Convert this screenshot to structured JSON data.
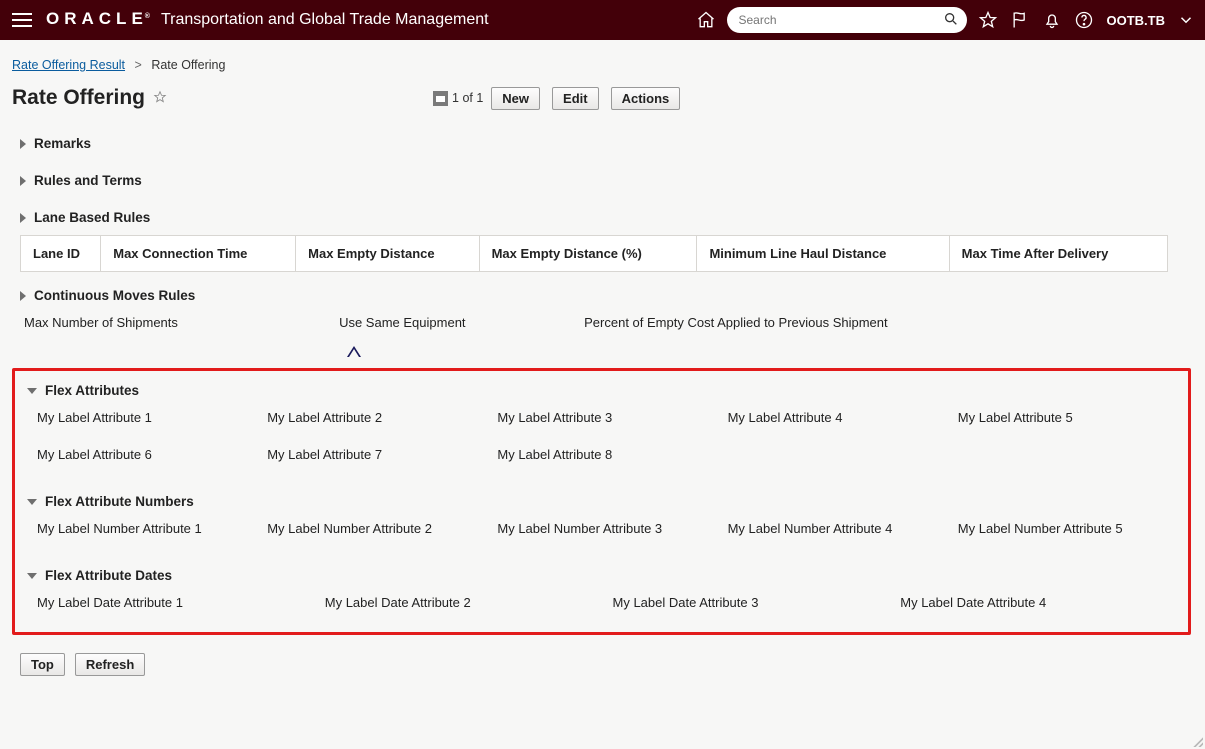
{
  "header": {
    "brand": "ORACLE",
    "brand_sup": "®",
    "suite": "Transportation and Global Trade Management",
    "search_placeholder": "Search",
    "user": "OOTB.TB"
  },
  "breadcrumb": {
    "link": "Rate Offering Result",
    "current": "Rate Offering"
  },
  "title": {
    "text": "Rate Offering",
    "record_counter": "1 of 1",
    "btn_new": "New",
    "btn_edit": "Edit",
    "btn_actions": "Actions"
  },
  "sections": {
    "remarks": "Remarks",
    "rules": "Rules and Terms",
    "lane": "Lane Based Rules",
    "lane_cols": [
      "Lane ID",
      "Max Connection Time",
      "Max Empty Distance",
      "Max Empty Distance (%)",
      "Minimum Line Haul Distance",
      "Max Time After Delivery"
    ],
    "cont": "Continuous Moves Rules",
    "cont_fields": [
      "Max Number of Shipments",
      "Use Same Equipment",
      "Percent of Empty Cost Applied to Previous Shipment"
    ],
    "flexa": "Flex Attributes",
    "flexa_cells": [
      "My Label Attribute 1",
      "My Label Attribute 2",
      "My Label Attribute 3",
      "My Label Attribute 4",
      "My Label Attribute 5",
      "My Label Attribute 6",
      "My Label Attribute 7",
      "My Label Attribute 8"
    ],
    "flexn": "Flex Attribute Numbers",
    "flexn_cells": [
      "My Label Number Attribute 1",
      "My Label Number Attribute 2",
      "My Label Number Attribute 3",
      "My Label Number Attribute 4",
      "My Label Number Attribute 5"
    ],
    "flexd": "Flex Attribute Dates",
    "flexd_cells": [
      "My Label Date Attribute 1",
      "My Label Date Attribute 2",
      "My Label Date Attribute 3",
      "My Label Date Attribute 4"
    ]
  },
  "footer": {
    "top": "Top",
    "refresh": "Refresh"
  }
}
